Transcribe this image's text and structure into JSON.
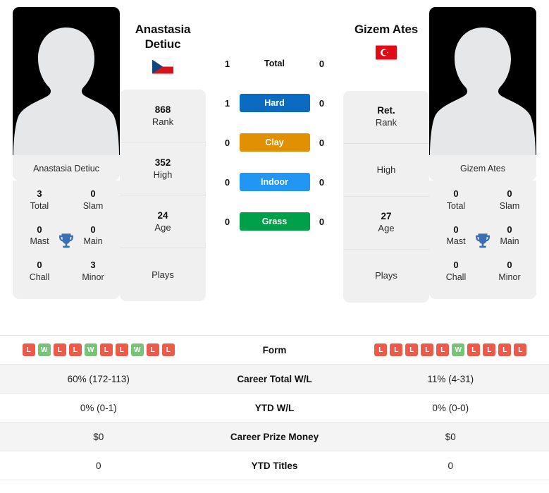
{
  "colors": {
    "hard": "#0a6bc1",
    "clay": "#e09000",
    "indoor": "#2196f3",
    "grass": "#00a04a",
    "win": "#78c279",
    "loss": "#ee5a4a",
    "trophy": "#3b6fb0",
    "panel_bg": "#f0f0f0"
  },
  "left_player": {
    "name": "Anastasia Detiuc",
    "name_line1": "Anastasia",
    "name_line2": "Detiuc",
    "country": "Czech Republic",
    "flag": "cz-flag",
    "avatar_alt": "player-photo-placeholder",
    "titles": [
      {
        "value": "3",
        "label": "Total"
      },
      {
        "value": "0",
        "label": "Slam"
      },
      {
        "value": "0",
        "label": "Mast"
      },
      {
        "value": "0",
        "label": "Main"
      },
      {
        "value": "0",
        "label": "Chall"
      },
      {
        "value": "3",
        "label": "Minor"
      }
    ],
    "profile": [
      {
        "value": "868",
        "label": "Rank"
      },
      {
        "value": "352",
        "label": "High"
      },
      {
        "value": "24",
        "label": "Age"
      },
      {
        "value": "",
        "label": "Plays"
      }
    ],
    "form": [
      "L",
      "W",
      "L",
      "L",
      "W",
      "L",
      "L",
      "W",
      "L",
      "L"
    ],
    "career_total_wl": "60% (172-113)",
    "ytd_wl": "0% (0-1)",
    "career_prize_money": "$0",
    "ytd_titles": "0"
  },
  "right_player": {
    "name": "Gizem Ates",
    "name_line1": "Gizem Ates",
    "name_line2": "",
    "country": "Turkey",
    "flag": "tr-flag",
    "avatar_alt": "player-photo-placeholder",
    "titles": [
      {
        "value": "0",
        "label": "Total"
      },
      {
        "value": "0",
        "label": "Slam"
      },
      {
        "value": "0",
        "label": "Mast"
      },
      {
        "value": "0",
        "label": "Main"
      },
      {
        "value": "0",
        "label": "Chall"
      },
      {
        "value": "0",
        "label": "Minor"
      }
    ],
    "profile": [
      {
        "value": "Ret.",
        "label": "Rank"
      },
      {
        "value": "",
        "label": "High"
      },
      {
        "value": "27",
        "label": "Age"
      },
      {
        "value": "",
        "label": "Plays"
      }
    ],
    "form": [
      "L",
      "L",
      "L",
      "L",
      "L",
      "W",
      "L",
      "L",
      "L",
      "L"
    ],
    "career_total_wl": "11% (4-31)",
    "ytd_wl": "0% (0-0)",
    "career_prize_money": "$0",
    "ytd_titles": "0"
  },
  "head_to_head": [
    {
      "surface": "Total",
      "left": "1",
      "right": "0",
      "badge": false,
      "color": ""
    },
    {
      "surface": "Hard",
      "left": "1",
      "right": "0",
      "badge": true,
      "color": "#0a6bc1"
    },
    {
      "surface": "Clay",
      "left": "0",
      "right": "0",
      "badge": true,
      "color": "#e09000"
    },
    {
      "surface": "Indoor",
      "left": "0",
      "right": "0",
      "badge": true,
      "color": "#2196f3"
    },
    {
      "surface": "Grass",
      "left": "0",
      "right": "0",
      "badge": true,
      "color": "#00a04a"
    }
  ],
  "stats_rows": [
    {
      "label": "Form",
      "type": "form"
    },
    {
      "label": "Career Total W/L",
      "type": "text",
      "left": "60% (172-113)",
      "right": "11% (4-31)"
    },
    {
      "label": "YTD W/L",
      "type": "text",
      "left": "0% (0-1)",
      "right": "0% (0-0)"
    },
    {
      "label": "Career Prize Money",
      "type": "text",
      "left": "$0",
      "right": "$0"
    },
    {
      "label": "YTD Titles",
      "type": "text",
      "left": "0",
      "right": "0"
    }
  ]
}
